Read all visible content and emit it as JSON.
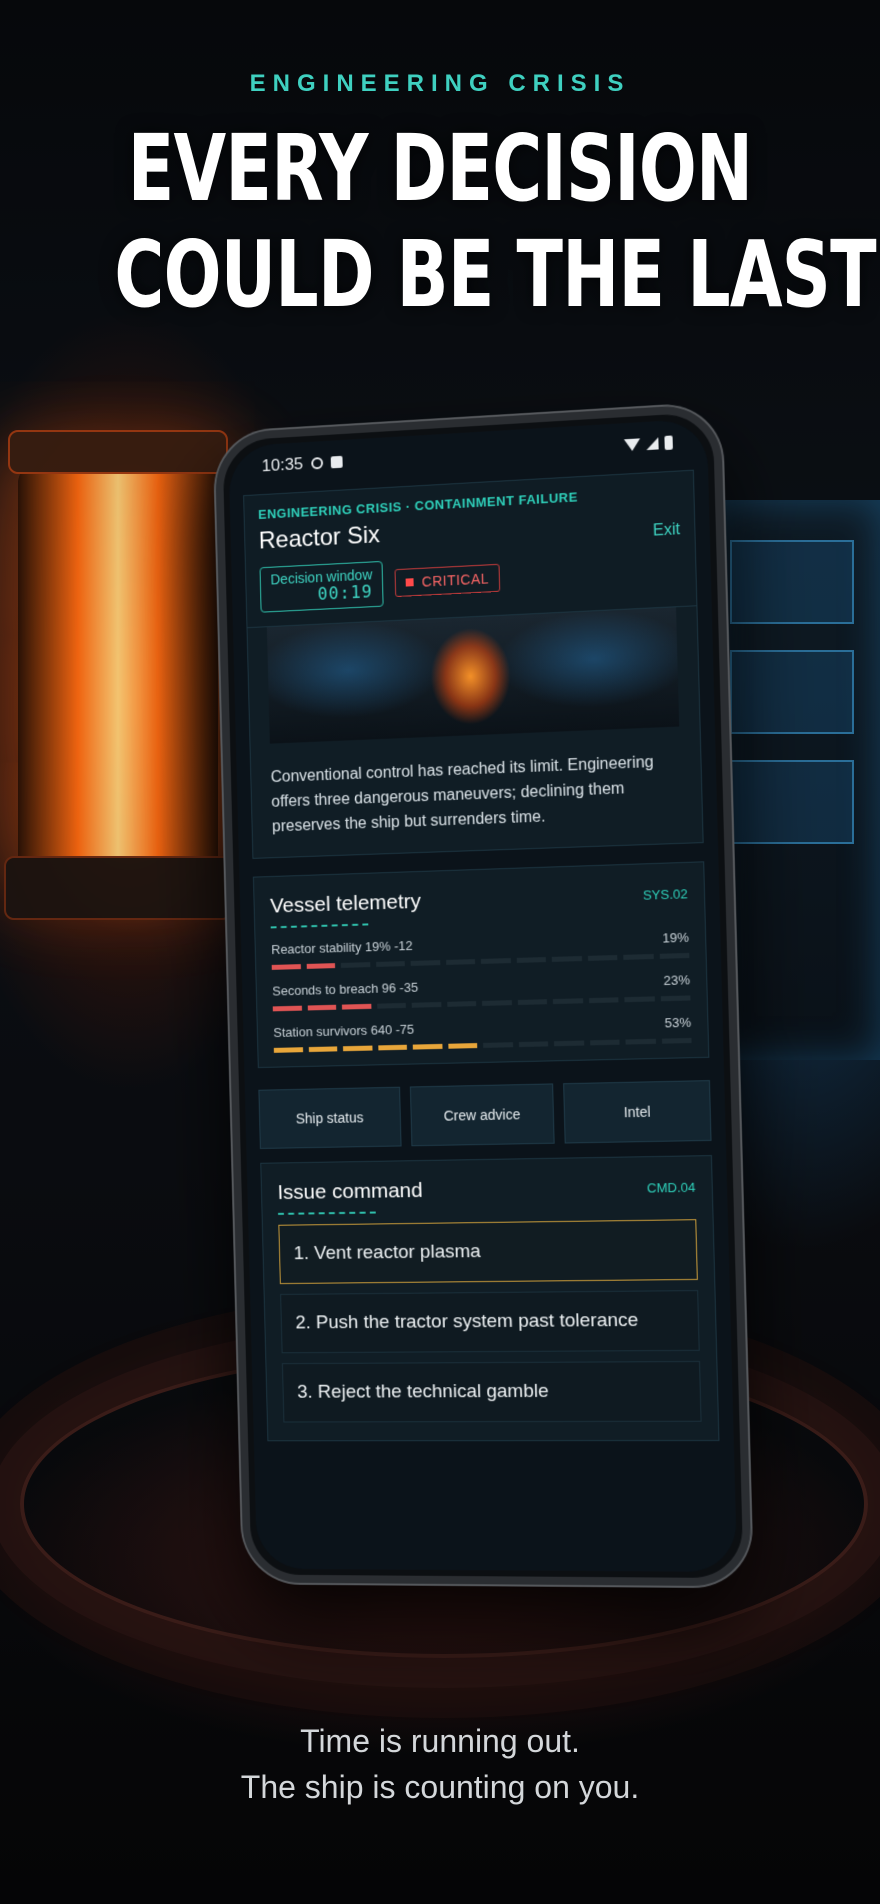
{
  "hero": {
    "eyebrow": "ENGINEERING CRISIS",
    "title_line1": "EVERY DECISION",
    "title_line2": "COULD BE THE LAST",
    "tagline_line1": "Time is running out.",
    "tagline_line2": "The ship is counting on you."
  },
  "status_bar": {
    "time": "10:35"
  },
  "header": {
    "eyebrow": "ENGINEERING CRISIS · CONTAINMENT FAILURE",
    "title": "Reactor Six",
    "exit_label": "Exit",
    "timer_label": "Decision window",
    "timer_value": "00:19",
    "severity": "CRITICAL"
  },
  "story": {
    "text": "Conventional control has reached its limit. Engineering offers three dangerous maneuvers; declining them preserves the ship but surrenders time."
  },
  "telemetry": {
    "title": "Vessel telemetry",
    "code": "SYS.02",
    "metrics": [
      {
        "label": "Reactor stability  19%  -12",
        "percent": "19%",
        "value": 19,
        "color": "red"
      },
      {
        "label": "Seconds to breach  96  -35",
        "percent": "23%",
        "value": 23,
        "color": "red"
      },
      {
        "label": "Station survivors  640  -75",
        "percent": "53%",
        "value": 53,
        "color": "amber"
      }
    ]
  },
  "tabs": [
    "Ship status",
    "Crew advice",
    "Intel"
  ],
  "command": {
    "title": "Issue command",
    "code": "CMD.04",
    "options": [
      "1. Vent reactor plasma",
      "2. Push the tractor system past tolerance",
      "3. Reject the technical gamble"
    ],
    "selected_index": 0
  },
  "colors": {
    "accent": "#2fd1bb",
    "critical": "#ff4a4a",
    "amber": "#e8a63a",
    "selected_border": "#c79a3a"
  }
}
